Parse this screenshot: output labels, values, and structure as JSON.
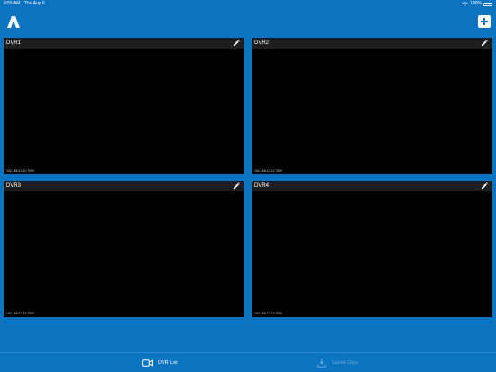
{
  "status_bar": {
    "time": "9:55 AM",
    "date": "Thu Aug 6",
    "battery": "100%"
  },
  "header": {
    "logo_icon": "app-logo-icon",
    "add_icon": "plus-icon"
  },
  "dvrs": [
    {
      "name": "DVR1",
      "ip": "192.168.10.10:7000"
    },
    {
      "name": "DVR2",
      "ip": "192.168.10.11:7000"
    },
    {
      "name": "DVR3",
      "ip": "192.168.10.12:7000"
    },
    {
      "name": "DVR4",
      "ip": "192.168.10.13:7000"
    }
  ],
  "tab_bar": {
    "dvr_list": "DVR List",
    "saved_clips": "Saved Clips"
  },
  "colors": {
    "background": "#0a73c2",
    "tile": "#000000",
    "tile_header": "#1e1e20",
    "inactive_tab": "#6fa8d6"
  }
}
